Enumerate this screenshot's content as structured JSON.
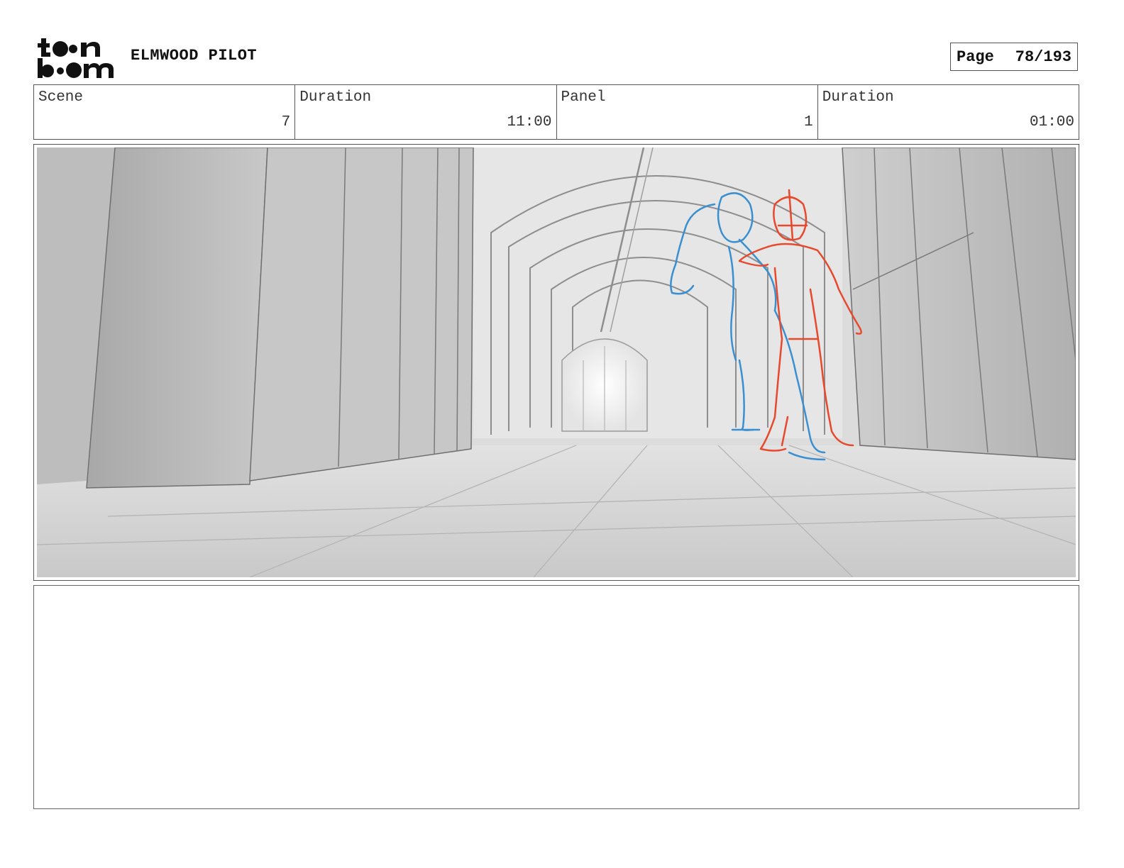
{
  "header": {
    "project_title": "ELMWOOD PILOT",
    "page_label": "Page",
    "page_value": "78/193"
  },
  "info": {
    "scene_label": "Scene",
    "scene_value": "7",
    "scene_duration_label": "Duration",
    "scene_duration_value": "11:00",
    "panel_label": "Panel",
    "panel_value": "1",
    "panel_duration_label": "Duration",
    "panel_duration_value": "01:00"
  },
  "panel_image": {
    "style": "rough grayscale storyboard sketch",
    "colors": {
      "character_a": "#3a8fd0",
      "character_b": "#e8482c",
      "background": "#cfcfcf"
    }
  },
  "notes": {
    "text": ""
  }
}
